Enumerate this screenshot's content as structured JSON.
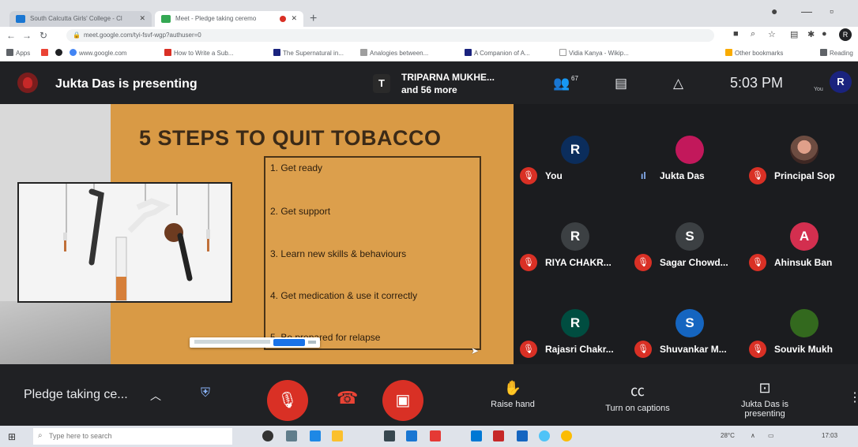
{
  "browser": {
    "tabs": [
      {
        "title": "South Calcutta Girls' College - Cl"
      },
      {
        "title": "Meet - Pledge taking ceremo"
      }
    ],
    "url": "meet.google.com/tyi-fsvf-wgp?authuser=0",
    "bookmarks": [
      "Apps",
      "www.google.com",
      "How to Write a Sub...",
      "The Supernatural in...",
      "Analogies between...",
      "A Companion of A...",
      "Vidia Kanya - Wikip...",
      "Other bookmarks",
      "Reading"
    ],
    "profile_initial": "R"
  },
  "meet": {
    "presenting_label": "Jukta Das is presenting",
    "pinned_initial": "T",
    "pinned_name": "TRIPARNA MUKHE...",
    "pinned_more": "and 56 more",
    "people_count": "67",
    "clock": "5:03 PM",
    "self_label": "You",
    "self_initial": "R",
    "meeting_name": "Pledge taking ce...",
    "controls": {
      "raise_hand": "Raise hand",
      "captions": "Turn on captions",
      "presenting": "Jukta Das is presenting"
    }
  },
  "slide": {
    "title": "5 STEPS TO QUIT TOBACCO",
    "steps": [
      "1. Get ready",
      "2. Get support",
      "3. Learn new skills & behaviours",
      "4. Get medication & use it correctly",
      "5. Be prepared for relapse"
    ]
  },
  "participants": [
    {
      "initial": "R",
      "name": "You",
      "color": "#0b2d5c",
      "muted": true
    },
    {
      "initial": "",
      "name": "Jukta Das",
      "color": "#c2185b",
      "muted": false
    },
    {
      "initial": "",
      "name": "Principal Sop",
      "color": "#6d4c41",
      "muted": true
    },
    {
      "initial": "R",
      "name": "RIYA CHAKR...",
      "color": "#3c4043",
      "muted": true
    },
    {
      "initial": "S",
      "name": "Sagar Chowd...",
      "color": "#3c4043",
      "muted": true
    },
    {
      "initial": "A",
      "name": "Ahinsuk Ban",
      "color": "#d32f4f",
      "muted": true
    },
    {
      "initial": "R",
      "name": "Rajasri Chakr...",
      "color": "#004d40",
      "muted": true
    },
    {
      "initial": "S",
      "name": "Shuvankar M...",
      "color": "#1565c0",
      "muted": true
    },
    {
      "initial": "",
      "name": "Souvik Mukh",
      "color": "#33691e",
      "muted": true
    }
  ],
  "taskbar": {
    "search_placeholder": "Type here to search",
    "weather": "28°C",
    "time": "17:03"
  }
}
